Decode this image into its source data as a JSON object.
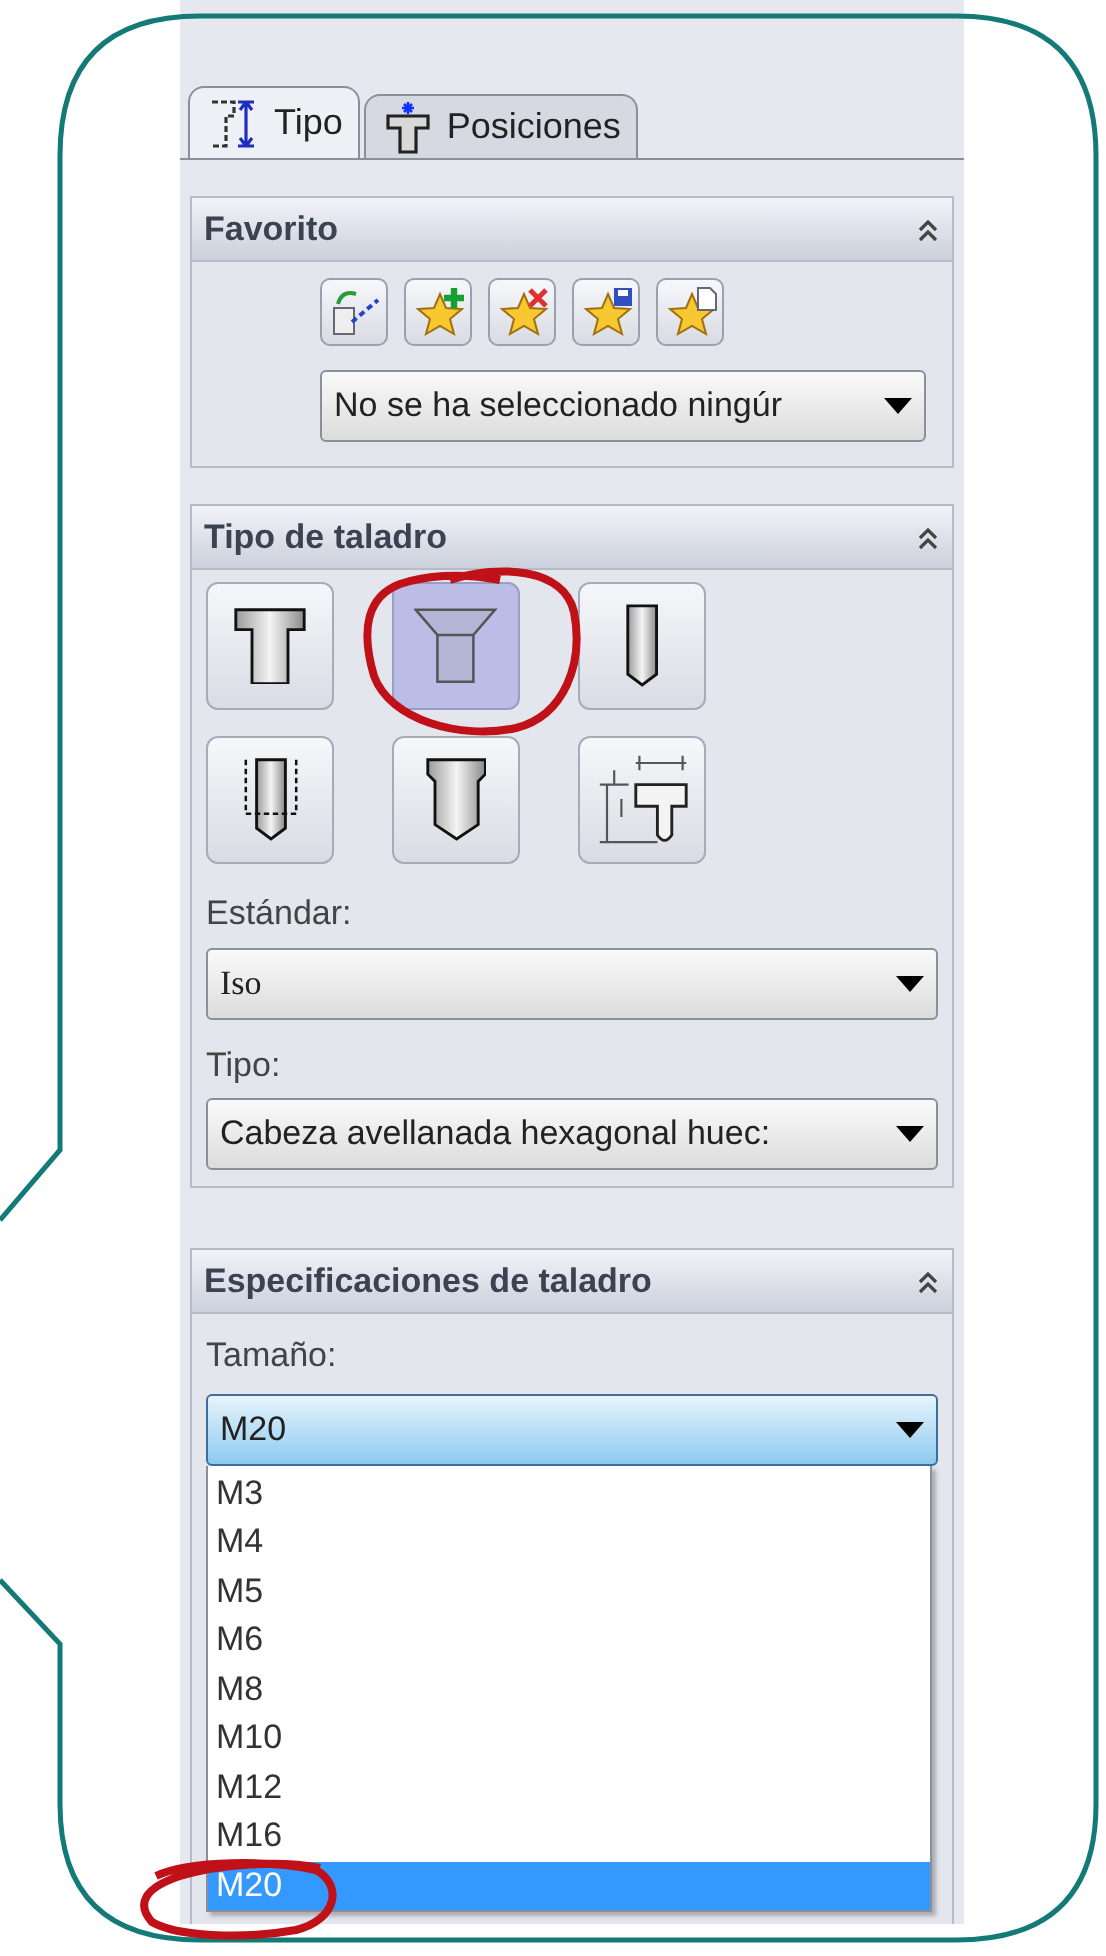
{
  "tabs": [
    {
      "label": "Tipo",
      "selected": true
    },
    {
      "label": "Posiciones",
      "selected": false
    }
  ],
  "favorite": {
    "title": "Favorito",
    "dropdown": {
      "value": "No se ha seleccionado ningúr"
    }
  },
  "hole_type": {
    "title": "Tipo de taladro",
    "types": [
      {
        "kind": "counterbore",
        "selected": false
      },
      {
        "kind": "countersink",
        "selected": true
      },
      {
        "kind": "hole",
        "selected": false
      },
      {
        "kind": "tap",
        "selected": false
      },
      {
        "kind": "pipe_tap",
        "selected": false
      },
      {
        "kind": "legacy",
        "selected": false
      }
    ],
    "standard_label": "Estándar:",
    "standard_value": "Iso",
    "type_label": "Tipo:",
    "type_value": "Cabeza avellanada hexagonal huec:"
  },
  "hole_specs": {
    "title": "Especificaciones de taladro",
    "size_label": "Tamaño:",
    "size_value": "M20",
    "size_options": [
      {
        "label": "M3",
        "selected": false
      },
      {
        "label": "M4",
        "selected": false
      },
      {
        "label": "M5",
        "selected": false
      },
      {
        "label": "M6",
        "selected": false
      },
      {
        "label": "M8",
        "selected": false
      },
      {
        "label": "M10",
        "selected": false
      },
      {
        "label": "M12",
        "selected": false
      },
      {
        "label": "M16",
        "selected": false
      },
      {
        "label": "M20",
        "selected": true
      }
    ]
  }
}
